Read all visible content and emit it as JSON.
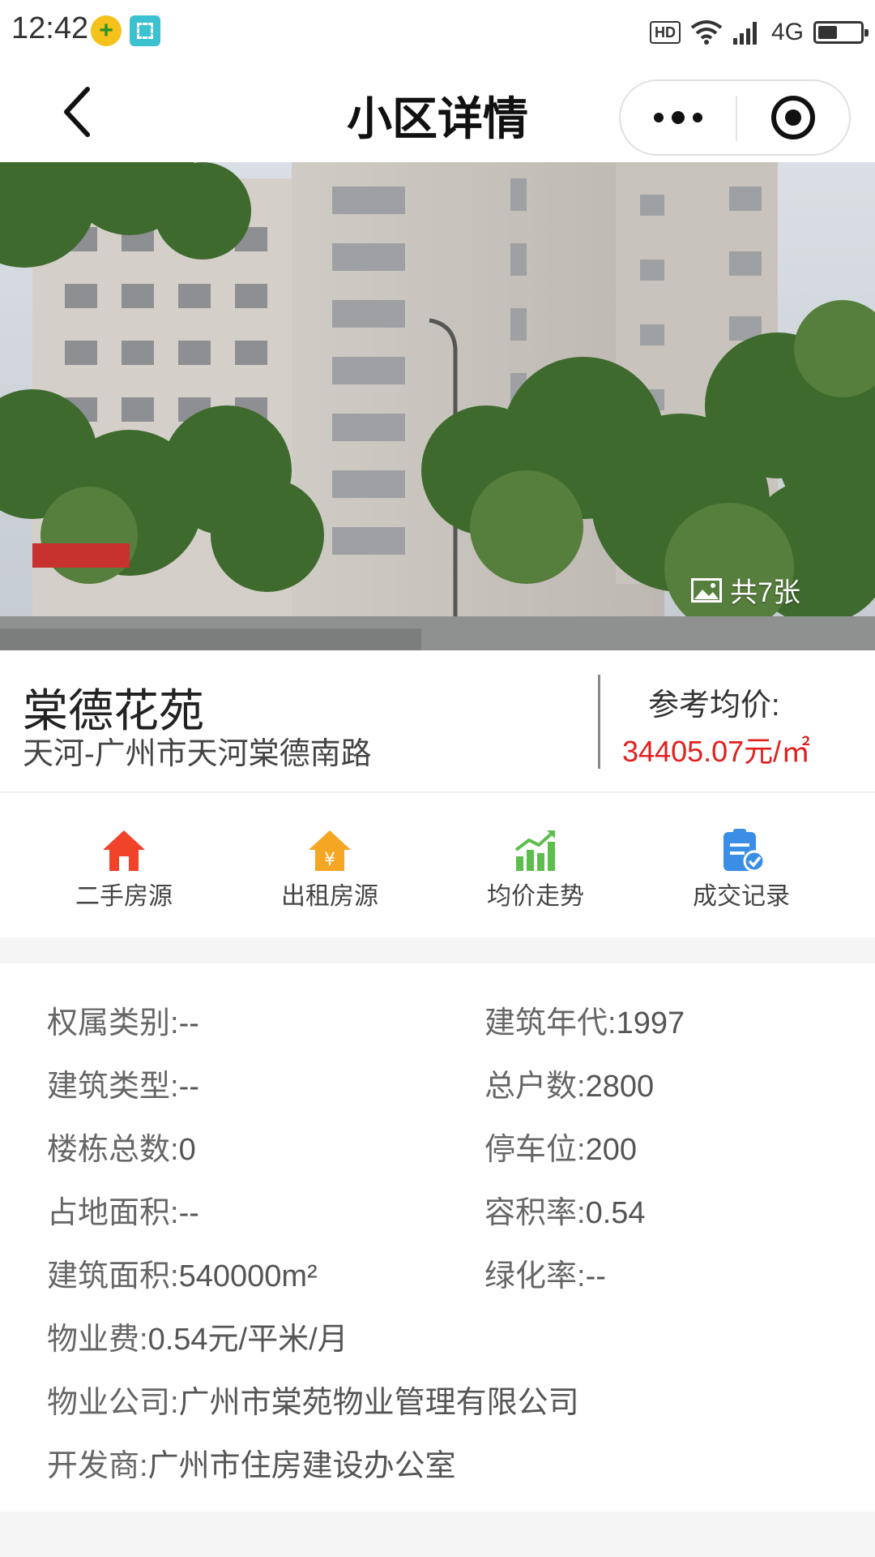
{
  "status_bar": {
    "time": "12:42",
    "hd": "HD",
    "network": "4G",
    "battery_level": 0.45,
    "icons": [
      "app-notification-icon",
      "scan-icon",
      "hd-icon",
      "wifi-icon",
      "signal-icon",
      "battery-icon"
    ]
  },
  "nav": {
    "title": "小区详情",
    "icons": [
      "back-arrow-icon",
      "more-dots-icon",
      "close-target-icon"
    ]
  },
  "hero": {
    "photo_count": "共7张",
    "icon": "image-icon"
  },
  "community": {
    "name": "棠德花苑",
    "address": "天河-广州市天河棠德南路",
    "price_label": "参考均价:",
    "price_value": "34405.07元/㎡"
  },
  "quick_nav": [
    {
      "label": "二手房源",
      "icon": "house-icon",
      "color": "#f0432a"
    },
    {
      "label": "出租房源",
      "icon": "rent-house-icon",
      "color": "#f5a623"
    },
    {
      "label": "均价走势",
      "icon": "trend-chart-icon",
      "color": "#5cbf4d"
    },
    {
      "label": "成交记录",
      "icon": "clipboard-check-icon",
      "color": "#3a8ee6"
    }
  ],
  "details": {
    "left": [
      {
        "key": "权属类别:",
        "value": "--"
      },
      {
        "key": "建筑类型:",
        "value": "--"
      },
      {
        "key": "楼栋总数:",
        "value": "0"
      },
      {
        "key": "占地面积:",
        "value": "--"
      },
      {
        "key": "建筑面积:",
        "value": "540000m²"
      }
    ],
    "right": [
      {
        "key": "建筑年代:",
        "value": "1997"
      },
      {
        "key": "总户数:",
        "value": "2800"
      },
      {
        "key": "停车位:",
        "value": "200"
      },
      {
        "key": "容积率:",
        "value": "0.54"
      },
      {
        "key": "绿化率:",
        "value": "--"
      }
    ],
    "full": [
      {
        "key": "物业费:",
        "value": "0.54元/平米/月"
      },
      {
        "key": "物业公司:",
        "value": "广州市棠苑物业管理有限公司"
      },
      {
        "key": "开发商:",
        "value": "广州市住房建设办公室"
      }
    ]
  }
}
